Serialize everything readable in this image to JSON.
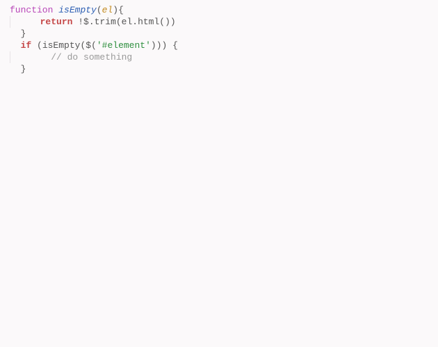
{
  "code": {
    "l1": {
      "kw": "function",
      "name": "isEmpty",
      "paren_open": "(",
      "param": "el",
      "paren_close_brace": "){"
    },
    "l2": {
      "indent": "    ",
      "kw": "return",
      "space": " ",
      "bang": "!",
      "dollar": "$",
      "rest": ".trim(el.html())"
    },
    "l3": {
      "indent": "  ",
      "brace": "}"
    },
    "l4": {
      "indent": "  ",
      "kw": "if",
      "space": " ",
      "open": "(isEmpty(",
      "dollar": "$",
      "paren": "(",
      "str": "'#element'",
      "close": "))) {"
    },
    "l5": {
      "indent": "      ",
      "comment": "// do something"
    },
    "l6": {
      "indent": "  ",
      "brace": "}"
    }
  }
}
